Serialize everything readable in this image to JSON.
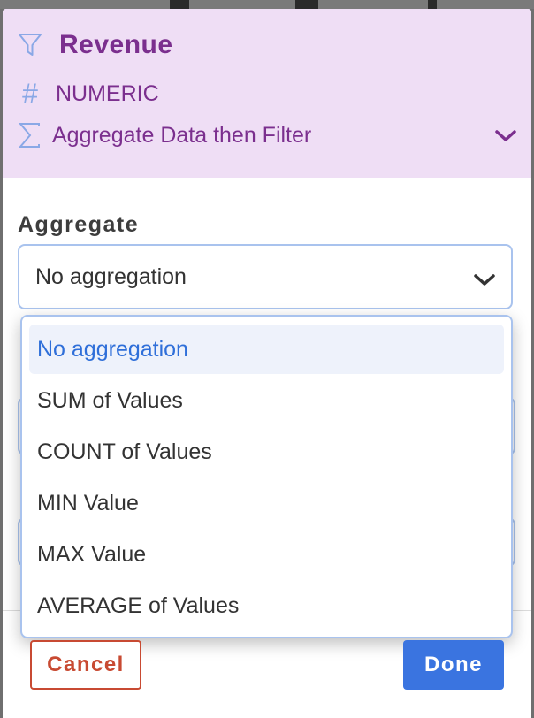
{
  "header": {
    "title": "Revenue",
    "type": "NUMERIC",
    "mode": "Aggregate Data then Filter",
    "icons": [
      "filter-icon",
      "hash-icon",
      "sigma-icon",
      "chevron-down-icon"
    ]
  },
  "aggregate": {
    "label": "Aggregate",
    "selected": "No aggregation",
    "options": [
      "No aggregation",
      "SUM of Values",
      "COUNT of Values",
      "MIN Value",
      "MAX Value",
      "AVERAGE of Values"
    ]
  },
  "footer": {
    "cancel_label": "Cancel",
    "done_label": "Done"
  },
  "colors": {
    "header_bg": "#efdef5",
    "header_text": "#7b2f8e",
    "icon": "#8aa8e6",
    "selected_text": "#2f6fd9",
    "cancel": "#c84a32",
    "done": "#3a74e0"
  }
}
